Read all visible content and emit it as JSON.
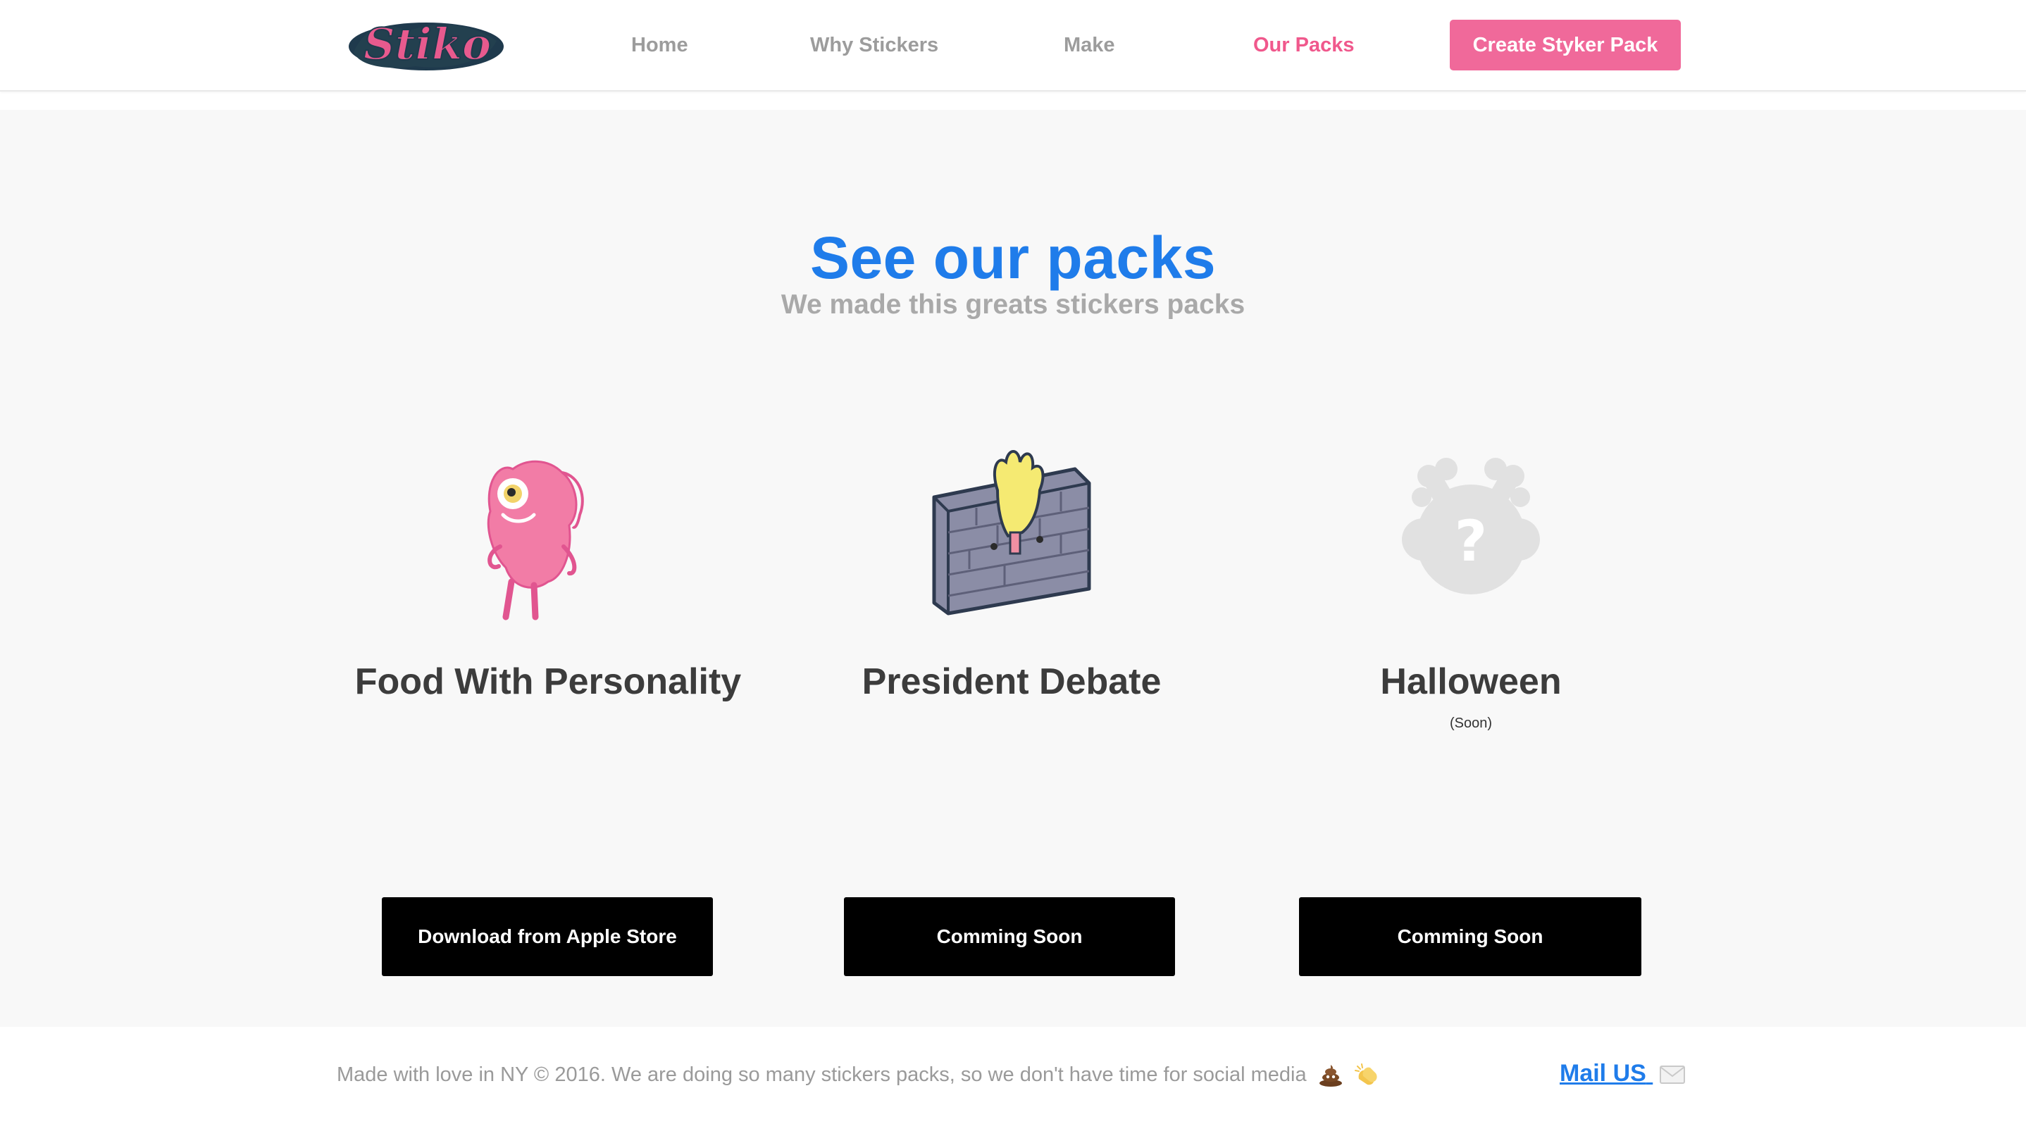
{
  "header": {
    "logo_text": "Stiko",
    "nav": [
      {
        "label": "Home",
        "active": false
      },
      {
        "label": "Why Stickers",
        "active": false
      },
      {
        "label": "Make",
        "active": false
      },
      {
        "label": "Our Packs",
        "active": true
      }
    ],
    "cta_label": "Create Styker Pack"
  },
  "hero": {
    "title": "See our packs",
    "subtitle": "We made this greats stickers packs"
  },
  "packs": [
    {
      "title": "Food With Personality",
      "note": "",
      "button": "Download from Apple Store",
      "icon": "pink-steak-character-icon"
    },
    {
      "title": "President Debate",
      "note": "",
      "button": "Comming Soon",
      "icon": "brick-wall-hand-icon"
    },
    {
      "title": "Halloween",
      "note": "(Soon)",
      "button": "Comming Soon",
      "icon": "mystery-question-icon"
    }
  ],
  "footer": {
    "text": "Made with love in NY © 2016. We are doing so many stickers packs, so we don't have time for social media",
    "emojis": [
      "poop-emoji",
      "clapping-hands-emoji"
    ],
    "mail_label": "Mail US",
    "mail_icon": "envelope-icon"
  },
  "colors": {
    "accent_pink": "#f0699a",
    "active_nav": "#f0588c",
    "title_blue": "#1f7cea",
    "button_black": "#000000",
    "section_bg": "#f8f8f8"
  }
}
